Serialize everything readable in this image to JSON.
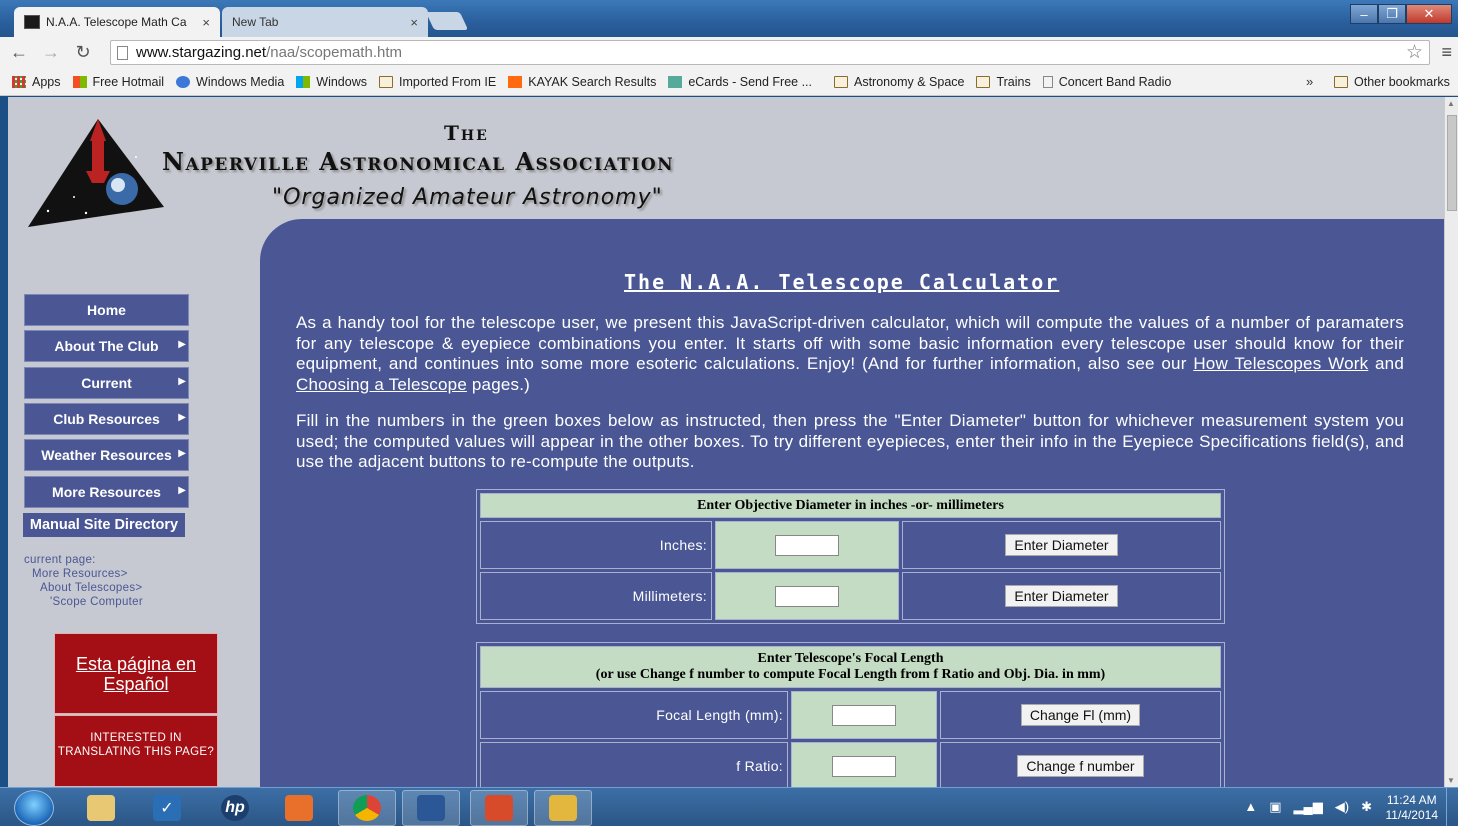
{
  "browser": {
    "tabs": [
      {
        "label": "N.A.A. Telescope Math Ca",
        "close": "×"
      },
      {
        "label": "New Tab",
        "close": "×"
      }
    ],
    "url_host": "www.stargazing.net",
    "url_path": "/naa/scopemath.htm",
    "bookmarks": [
      {
        "label": "Apps",
        "icon": "apps-grid-icon"
      },
      {
        "label": "Free Hotmail",
        "icon": "msn-icon"
      },
      {
        "label": "Windows Media",
        "icon": "windows-media-icon"
      },
      {
        "label": "Windows",
        "icon": "windows-icon"
      },
      {
        "label": "Imported From IE",
        "icon": "folder-icon"
      },
      {
        "label": "KAYAK Search Results",
        "icon": "kayak-icon"
      },
      {
        "label": "eCards - Send Free ...",
        "icon": "ecard-icon"
      },
      {
        "label": "Astronomy & Space",
        "icon": "folder-icon"
      },
      {
        "label": "Trains",
        "icon": "folder-icon"
      },
      {
        "label": "Concert Band Radio",
        "icon": "page-icon"
      }
    ],
    "bookmarks_overflow": "»",
    "other_bookmarks": "Other bookmarks"
  },
  "header": {
    "the": "The",
    "org_name": "Naperville Astronomical Association",
    "slogan": "\"Organized Amateur Astronomy\""
  },
  "sidebar": {
    "nav": [
      {
        "label": "Home",
        "has_arrow": false
      },
      {
        "label": "About The Club",
        "has_arrow": true
      },
      {
        "label": "Current",
        "has_arrow": true
      },
      {
        "label": "Club Resources",
        "has_arrow": true
      },
      {
        "label": "Weather Resources",
        "has_arrow": true
      },
      {
        "label": "More Resources",
        "has_arrow": true
      }
    ],
    "arrow": "▶",
    "directory": "Manual Site Directory",
    "crumbs": [
      "current page:",
      "More Resources>",
      "About Telescopes>",
      "'Scope Computer"
    ],
    "spanish_link": "Esta página en Español",
    "translate_note": "INTERESTED IN TRANSLATING THIS PAGE?"
  },
  "main": {
    "title": "The N.A.A. Telescope Calculator",
    "para1_a": "As a handy tool for the telescope user, we present this JavaScript-driven calculator, which will compute the values of a number of paramaters for any telescope & eyepiece combinations you enter. It starts off with some basic information every telescope user should know for their equipment, and continues into some more esoteric calculations. Enjoy! (And for further information, also see our ",
    "link_how": "How Telescopes Work",
    "para1_and": " and ",
    "link_choosing": "Choosing a Telescope",
    "para1_end": " pages.)",
    "para2": "Fill in the numbers in the green boxes below as instructed, then press the \"Enter Diameter\" button for whichever measurement system you used; the computed values will appear in the other boxes. To try different eyepieces, enter their info in the Eyepiece Specifications field(s), and use the adjacent buttons to re-compute the outputs.",
    "table1": {
      "header": "Enter Objective Diameter in inches -or- millimeters",
      "rows": [
        {
          "label": "Inches:",
          "value": "",
          "button": "Enter Diameter"
        },
        {
          "label": "Millimeters:",
          "value": "",
          "button": "Enter Diameter"
        }
      ]
    },
    "table2": {
      "header_line1": "Enter Telescope's Focal Length",
      "header_line2": "(or use Change f number to compute Focal Length from f Ratio and Obj. Dia. in mm)",
      "rows": [
        {
          "label": "Focal Length (mm):",
          "value": "",
          "button": "Change Fl (mm)"
        },
        {
          "label": "f Ratio:",
          "value": "",
          "button": "Change f number"
        }
      ]
    }
  },
  "taskbar": {
    "time": "11:24 AM",
    "date": "11/4/2014",
    "apps": [
      "explorer",
      "checkmark",
      "hp",
      "media-player",
      "chrome",
      "word",
      "outlook-calendar",
      "outlook"
    ]
  }
}
